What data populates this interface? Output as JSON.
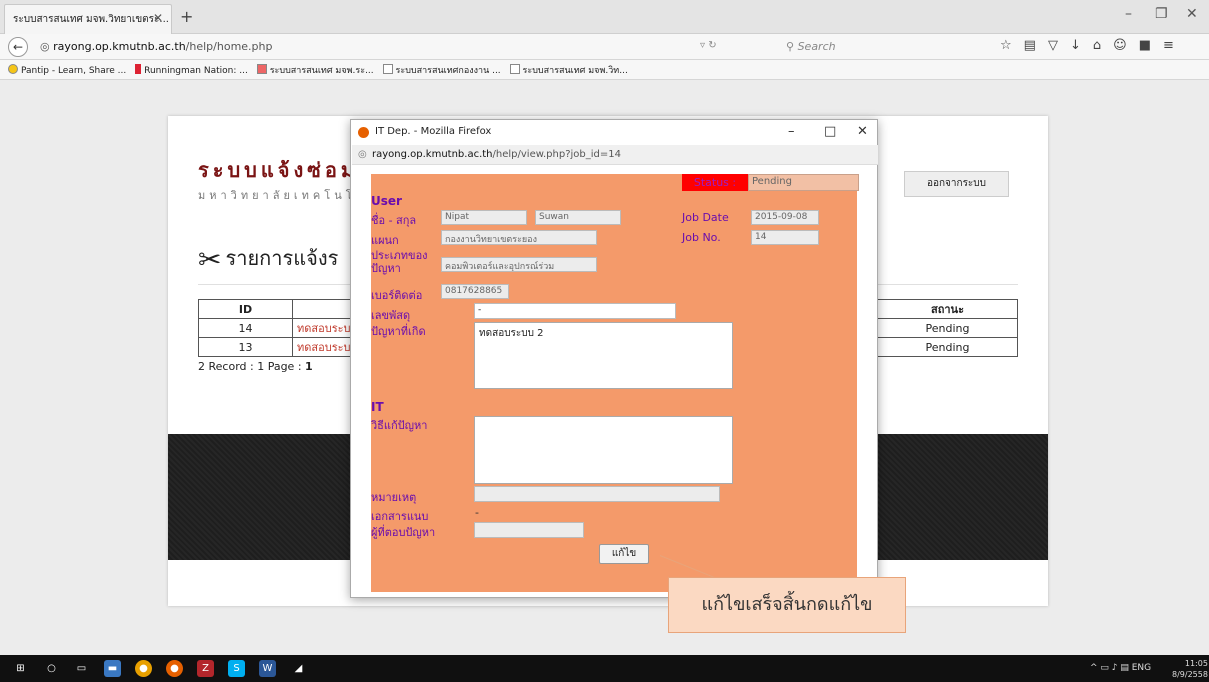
{
  "browser": {
    "tab_title": "ระบบสารสนเทศ มจพ.วิทยาเขตระ...",
    "url_host": "rayong.op.kmutnb.ac.th",
    "url_path": "/help/home.php",
    "search_placeholder": "Search",
    "bookmarks": [
      {
        "label": "Pantip - Learn, Share ..."
      },
      {
        "label": "Runningman Nation: ..."
      },
      {
        "label": "ระบบสารสนเทศ มจพ.ระ..."
      },
      {
        "label": "ระบบสารสนเทศกองงาน ..."
      },
      {
        "label": "ระบบสารสนเทศ มจพ.วิท..."
      }
    ]
  },
  "page": {
    "site_title": "ระบบแจ้งซ่อม",
    "site_subtitle": "มหาวิทยาลัยเทคโนโล",
    "logout_label": "ออกจากระบบ",
    "list_heading": "รายการแจ้งร",
    "table": {
      "headers": {
        "id": "ID",
        "status": "สถานะ"
      },
      "rows": [
        {
          "id": "14",
          "title": "ทดสอบระบบ",
          "status": "Pending"
        },
        {
          "id": "13",
          "title": "ทดสอบระบบ",
          "status": "Pending"
        }
      ]
    },
    "record_info_prefix": "2 Record : 1 Page : ",
    "record_info_page": "1"
  },
  "popup": {
    "title": "IT Dep. - Mozilla Firefox",
    "url_host": "rayong.op.kmutnb.ac.th",
    "url_path": "/help/view.php?job_id=14",
    "status_label": "Status :",
    "status_value": "Pending",
    "user_section": "User",
    "name_label": "ชื่อ - สกุล",
    "first_name": "Nipat",
    "last_name": "Suwan",
    "department_label": "แผนก",
    "department": "กองงานวิทยาเขตระยอง",
    "problem_type_label": "ประเภทของปัญหา",
    "problem_type": "คอมพิวเตอร์และอุปกรณ์ร่วม",
    "phone_label": "เบอร์ติดต่อ",
    "phone": "0817628865",
    "asset_label": "เลขพัสดุ",
    "asset": "-",
    "problem_label": "ปัญหาที่เกิด",
    "problem": "ทดสอบระบบ 2",
    "job_date_label": "Job Date",
    "job_date": "2015-09-08",
    "job_no_label": "Job No.",
    "job_no": "14",
    "it_section": "IT",
    "solution_label": "วิธีแก้ปัญหา",
    "note_label": "หมายเหตุ",
    "attachment_label": "เอกสารแนบ",
    "attachment": "-",
    "responder_label": "ผู้ที่ตอบปัญหา",
    "save_label": "แก้ไข"
  },
  "callout": {
    "text": "แก้ไขเสร็จสิ้นกดแก้ไข"
  },
  "taskbar": {
    "language": "ENG",
    "time": "11:05",
    "date": "8/9/2558"
  }
}
